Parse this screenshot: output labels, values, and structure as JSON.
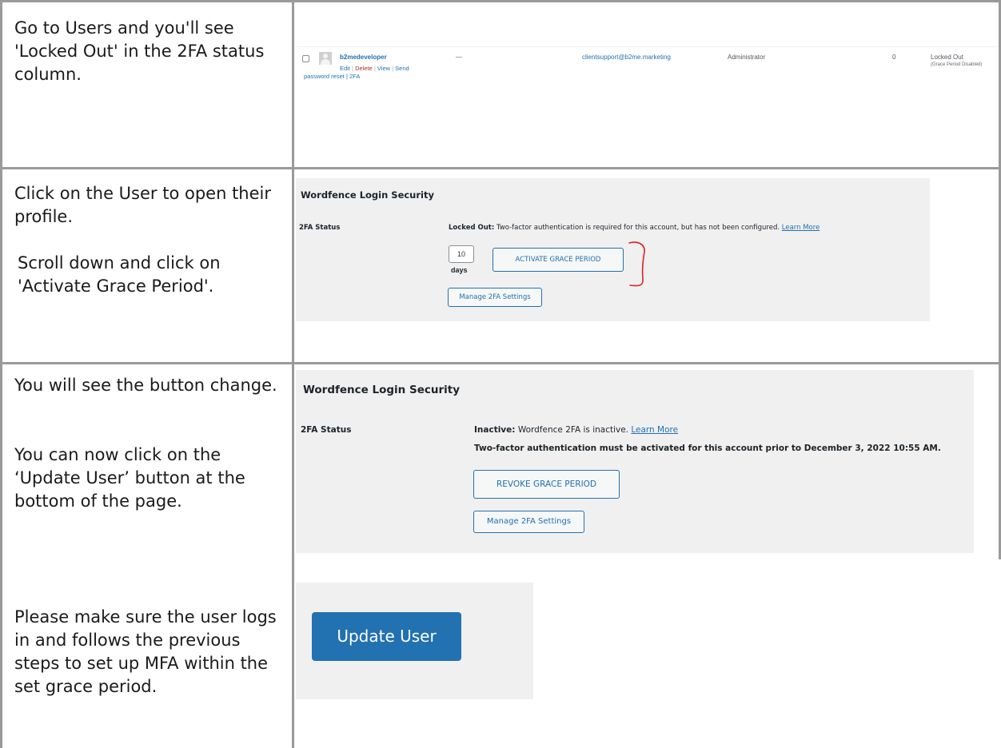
{
  "steps": [
    {
      "text": "Go to Users and you'll see 'Locked Out' in the 2FA status column."
    },
    {
      "text_1": "Click on the User to open their profile.",
      "text_2": "Scroll down and click on 'Activate Grace Period'."
    },
    {
      "text_1": "You will see the button change.",
      "text_2": "You can now click on the ‘Update User’ button at the bottom of the page."
    },
    {
      "text": "Please make sure the user logs in and follows the previous steps to set up MFA within the set grace period."
    }
  ],
  "users_row": {
    "username": "b2medeveloper",
    "action_edit": "Edit",
    "action_delete": "Delete",
    "action_view": "View",
    "action_send": "Send",
    "action_send_2": "password reset",
    "action_2fa": "2FA",
    "separator": "|",
    "name": "—",
    "email": "clientsupport@b2me.marketing",
    "role": "Administrator",
    "posts": "0",
    "status": "Locked Out",
    "status_sub": "(Grace Period Disabled)"
  },
  "panel_locked": {
    "title": "Wordfence Login Security",
    "label": "2FA Status",
    "status_bold": "Locked Out:",
    "status_text": " Two-factor authentication is required for this account, but has not been configured. ",
    "learn_more": "Learn More",
    "days_value": "10",
    "days_label": "days",
    "activate_label": "ACTIVATE GRACE PERIOD",
    "manage_label": "Manage 2FA Settings"
  },
  "panel_inactive": {
    "title": "Wordfence Login Security",
    "label": "2FA Status",
    "status_bold": "Inactive:",
    "status_text": " Wordfence 2FA is inactive. ",
    "learn_more": "Learn More",
    "deadline": "Two-factor authentication must be activated for this account prior to December 3, 2022 10:55 AM.",
    "revoke_label": "REVOKE GRACE PERIOD",
    "manage_label": "Manage 2FA Settings"
  },
  "update_panel": {
    "button_label": "Update User"
  },
  "colors": {
    "wp_blue": "#2271b1",
    "panel_bg": "#f0f0f1",
    "annotation_red": "#e02020",
    "grid": "#9a9a9a"
  }
}
